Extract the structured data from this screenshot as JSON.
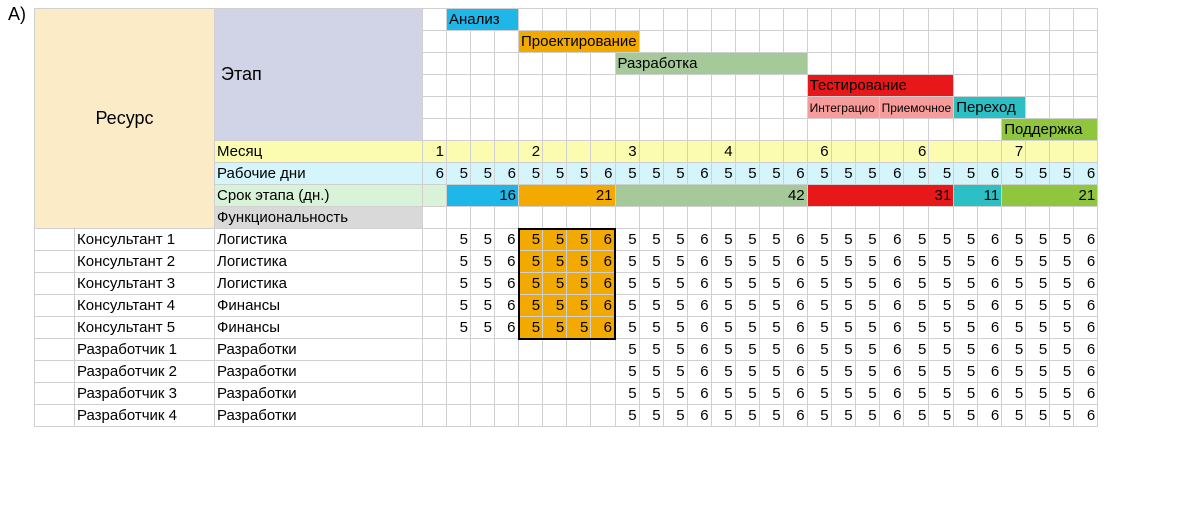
{
  "marker": "A)",
  "headers": {
    "resource": "Ресурс",
    "stage": "Этап",
    "month": "Месяц",
    "workdays": "Рабочие дни",
    "stagedur": "Срок этапа (дн.)",
    "functionality": "Функциональность"
  },
  "phases": {
    "analysis": "Анализ",
    "design": "Проектирование",
    "development": "Разработка",
    "testing": "Тестирование",
    "testing_sub1": "Интеграцио",
    "testing_sub2": "Приемочное",
    "transition": "Переход",
    "support": "Поддержка"
  },
  "months": [
    "1",
    "2",
    "3",
    "4",
    "6",
    "6",
    "7"
  ],
  "workdays": [
    "6",
    "5",
    "5",
    "6",
    "5",
    "5",
    "5",
    "6",
    "5",
    "5",
    "5",
    "6",
    "5",
    "5",
    "5",
    "6",
    "5",
    "5",
    "5",
    "6",
    "5",
    "5",
    "5",
    "6",
    "5",
    "5",
    "5",
    "6"
  ],
  "stagedur": {
    "analysis": "16",
    "design": "21",
    "development": "42",
    "testing": "31",
    "transition": "11",
    "support": "21"
  },
  "people": [
    {
      "name": "Консультант 1",
      "func": "Логистика",
      "days": [
        "",
        "5",
        "5",
        "6",
        "5",
        "5",
        "5",
        "6",
        "5",
        "5",
        "5",
        "6",
        "5",
        "5",
        "5",
        "6",
        "5",
        "5",
        "5",
        "6",
        "5",
        "5",
        "5",
        "6",
        "5",
        "5",
        "5",
        "6"
      ]
    },
    {
      "name": "Консультант 2",
      "func": "Логистика",
      "days": [
        "",
        "5",
        "5",
        "6",
        "5",
        "5",
        "5",
        "6",
        "5",
        "5",
        "5",
        "6",
        "5",
        "5",
        "5",
        "6",
        "5",
        "5",
        "5",
        "6",
        "5",
        "5",
        "5",
        "6",
        "5",
        "5",
        "5",
        "6"
      ]
    },
    {
      "name": "Консультант 3",
      "func": "Логистика",
      "days": [
        "",
        "5",
        "5",
        "6",
        "5",
        "5",
        "5",
        "6",
        "5",
        "5",
        "5",
        "6",
        "5",
        "5",
        "5",
        "6",
        "5",
        "5",
        "5",
        "6",
        "5",
        "5",
        "5",
        "6",
        "5",
        "5",
        "5",
        "6"
      ]
    },
    {
      "name": "Консультант 4",
      "func": "Финансы",
      "days": [
        "",
        "5",
        "5",
        "6",
        "5",
        "5",
        "5",
        "6",
        "5",
        "5",
        "5",
        "6",
        "5",
        "5",
        "5",
        "6",
        "5",
        "5",
        "5",
        "6",
        "5",
        "5",
        "5",
        "6",
        "5",
        "5",
        "5",
        "6"
      ]
    },
    {
      "name": "Консультант 5",
      "func": "Финансы",
      "days": [
        "",
        "5",
        "5",
        "6",
        "5",
        "5",
        "5",
        "6",
        "5",
        "5",
        "5",
        "6",
        "5",
        "5",
        "5",
        "6",
        "5",
        "5",
        "5",
        "6",
        "5",
        "5",
        "5",
        "6",
        "5",
        "5",
        "5",
        "6"
      ]
    },
    {
      "name": "Разработчик 1",
      "func": "Разработки",
      "days": [
        "",
        "",
        "",
        "",
        "",
        "",
        "",
        "",
        "5",
        "5",
        "5",
        "6",
        "5",
        "5",
        "5",
        "6",
        "5",
        "5",
        "5",
        "6",
        "5",
        "5",
        "5",
        "6",
        "5",
        "5",
        "5",
        "6"
      ]
    },
    {
      "name": "Разработчик 2",
      "func": "Разработки",
      "days": [
        "",
        "",
        "",
        "",
        "",
        "",
        "",
        "",
        "5",
        "5",
        "5",
        "6",
        "5",
        "5",
        "5",
        "6",
        "5",
        "5",
        "5",
        "6",
        "5",
        "5",
        "5",
        "6",
        "5",
        "5",
        "5",
        "6"
      ]
    },
    {
      "name": "Разработчик 3",
      "func": "Разработки",
      "days": [
        "",
        "",
        "",
        "",
        "",
        "",
        "",
        "",
        "5",
        "5",
        "5",
        "6",
        "5",
        "5",
        "5",
        "6",
        "5",
        "5",
        "5",
        "6",
        "5",
        "5",
        "5",
        "6",
        "5",
        "5",
        "5",
        "6"
      ]
    },
    {
      "name": "Разработчик 4",
      "func": "Разработки",
      "days": [
        "",
        "",
        "",
        "",
        "",
        "",
        "",
        "",
        "5",
        "5",
        "5",
        "6",
        "5",
        "5",
        "5",
        "6",
        "5",
        "5",
        "5",
        "6",
        "5",
        "5",
        "5",
        "6",
        "5",
        "5",
        "5",
        "6"
      ]
    }
  ],
  "chart_data": {
    "type": "table",
    "title": "Gantt-style resource plan",
    "columns": 28,
    "phase_spans": {
      "analysis": {
        "start": 2,
        "span": 3,
        "duration_days": 16
      },
      "design": {
        "start": 5,
        "span": 4,
        "duration_days": 21
      },
      "development": {
        "start": 9,
        "span": 8,
        "duration_days": 42
      },
      "testing": {
        "start": 17,
        "span": 6,
        "duration_days": 31,
        "sub": [
          {
            "label": "Интеграцио",
            "span": 3
          },
          {
            "label": "Приемочное",
            "span": 3
          }
        ]
      },
      "transition": {
        "start": 23,
        "span": 2,
        "duration_days": 11
      },
      "support": {
        "start": 25,
        "span": 4,
        "duration_days": 21
      }
    },
    "highlight": {
      "cols": [
        5,
        6,
        7,
        8
      ],
      "rows": [
        "Консультант 1",
        "Консультант 2",
        "Консультант 3",
        "Консультант 4",
        "Консультант 5"
      ]
    }
  }
}
